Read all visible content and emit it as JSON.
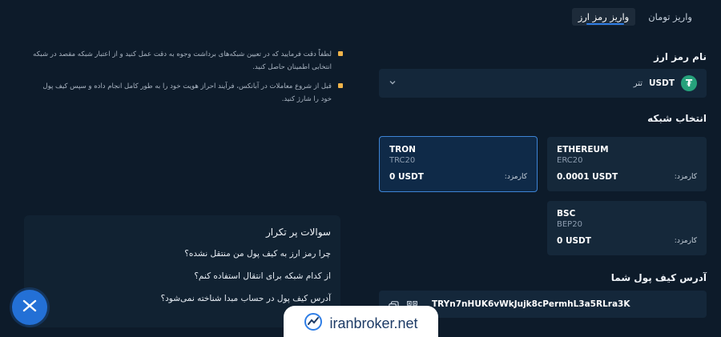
{
  "tabs": [
    {
      "label": "واریز تومان",
      "active": false
    },
    {
      "label": "واریز رمز ارز",
      "active": true
    }
  ],
  "currency_section": {
    "title": "نام رمز ارز",
    "selected_code": "USDT",
    "selected_name": "تتر",
    "icon": "tether-icon",
    "icon_glyph": "₮"
  },
  "network_section": {
    "title": "انتخاب شبکه",
    "fee_label": "کارمزد:",
    "networks": [
      {
        "name": "ETHEREUM",
        "standard": "ERC20",
        "fee": "0.0001 USDT",
        "selected": false
      },
      {
        "name": "TRON",
        "standard": "TRC20",
        "fee": "0 USDT",
        "selected": true
      },
      {
        "name": "BSC",
        "standard": "BEP20",
        "fee": "0 USDT",
        "selected": false
      }
    ]
  },
  "wallet_section": {
    "title": "آدرس کیف پول شما",
    "address": "TRYn7nHUK6vWkJujk8cPermhL3a5RLra3K"
  },
  "notices": [
    "لطفاً دقت فرمایید که در تعیین شبکه‌های برداشت وجوه به دقت عمل کنید و از اعتبار شبکه مقصد در شبکه انتخابی اطمینان حاصل کنید.",
    "قبل از شروع معاملات در آبانکس، فرآیند احراز هویت خود را به طور کامل انجام داده و سپس کیف پول خود را شارژ کنید."
  ],
  "faq": {
    "title": "سوالات پر تکرار",
    "questions": [
      "چرا رمز ارز به کیف پول من منتقل نشده؟",
      "از کدام شبکه برای انتقال استفاده کنم؟",
      "آدرس کیف پول در حساب مبدا شناخته نمی‌شود؟"
    ]
  },
  "watermark": {
    "text": "iranbroker.net"
  },
  "colors": {
    "accent": "#2f7ee6",
    "background": "#0d1b2a",
    "card": "#15283a",
    "warning": "#f0b44a",
    "tether": "#26a17b"
  }
}
